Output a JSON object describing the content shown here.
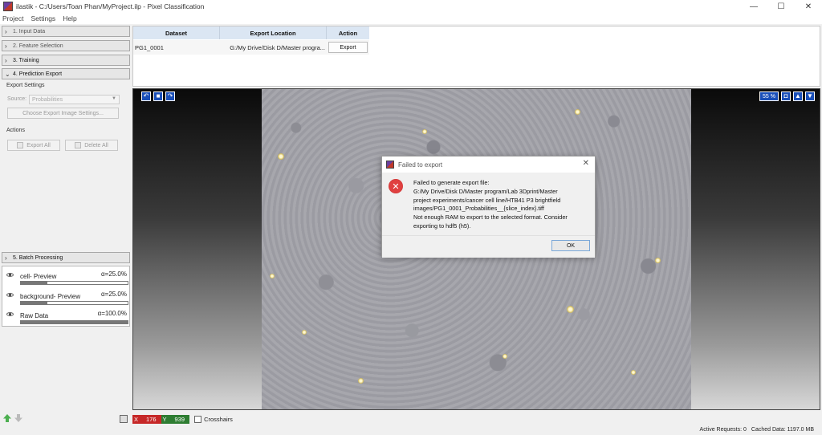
{
  "window": {
    "title": "ilastik - C:/Users/Toan Phan/MyProject.ilp - Pixel Classification",
    "minimize": "—",
    "maximize": "☐",
    "close": "✕"
  },
  "menu": [
    "Project",
    "Settings",
    "Help"
  ],
  "applets": [
    {
      "label": "1. Input Data",
      "expanded": false
    },
    {
      "label": "2. Feature Selection",
      "expanded": false
    },
    {
      "label": "3. Training",
      "expanded": false
    },
    {
      "label": "4. Prediction Export",
      "expanded": true
    },
    {
      "label": "5. Batch Processing",
      "expanded": false
    }
  ],
  "export_settings": {
    "title": "Export Settings",
    "source_label": "Source:",
    "source_value": "Probabilities",
    "choose_button": "Choose Export Image Settings...",
    "actions_title": "Actions",
    "export_all": "Export All",
    "delete_all": "Delete All"
  },
  "layers": [
    {
      "name": "cell- Preview",
      "alpha": "α=25.0%",
      "opacity": 0.25
    },
    {
      "name": "background- Preview",
      "alpha": "α=25.0%",
      "opacity": 0.25
    },
    {
      "name": "Raw Data",
      "alpha": "α=100.0%",
      "opacity": 1.0
    }
  ],
  "table": {
    "headers": [
      "Dataset",
      "Export Location",
      "Action"
    ],
    "rows": [
      {
        "dataset": "PG1_0001",
        "location": "G:/My Drive/Disk D/Master progra...",
        "action": "Export"
      }
    ]
  },
  "viewer": {
    "zoom": "55 %",
    "nav_icons": [
      "rotate-left-icon",
      "fit-icon",
      "rotate-right-icon"
    ],
    "view_icons": [
      "camera-icon",
      "up-icon",
      "down-icon"
    ]
  },
  "dialog": {
    "title": "Failed to export",
    "message": "Failed to generate export file:\nG:/My Drive/Disk D/Master program/Lab 3Dprint/Master\nproject experiments/cancer cell line/HTB41 P3 brightfield\nimages/PG1_0001_Probabilities__{slice_index}.tiff\nNot enough RAM to export to the selected format. Consider\nexporting to hdf5 (h5).",
    "ok": "OK",
    "close": "✕"
  },
  "coords": {
    "x_label": "X",
    "x_value": "176",
    "y_label": "Y",
    "y_value": "939",
    "crosshairs": "Crosshairs"
  },
  "status": {
    "active_requests": "Active Requests: 0",
    "cached_data": "Cached Data: 1197.0 MB"
  }
}
